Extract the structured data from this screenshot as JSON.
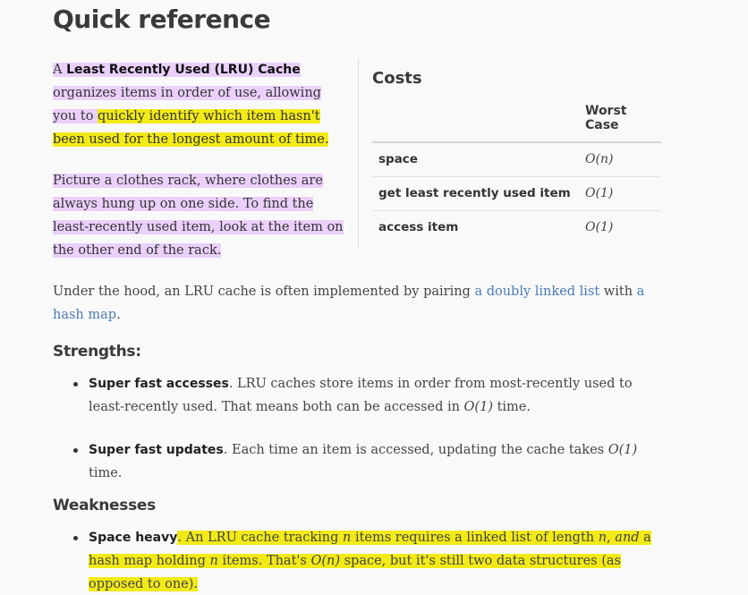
{
  "title": "Quick reference",
  "intro": {
    "p1": {
      "a": "A ",
      "term": "Least Recently Used (LRU) Cache",
      "rest": " organizes items in order of use, allowing you to ",
      "highlight": "quickly identify which item hasn't been used for the longest amount of time.",
      "end": ""
    },
    "p2": "Picture a clothes rack, where clothes are always hung up on one side. To find the least-recently used item, look at the item on the other end of the rack."
  },
  "costs": {
    "heading": "Costs",
    "col_header": "Worst Case",
    "rows": [
      {
        "op": "space",
        "cost": "O(n)"
      },
      {
        "op": "get least recently used item",
        "cost": "O(1)"
      },
      {
        "op": "access item",
        "cost": "O(1)"
      }
    ]
  },
  "hood": {
    "before": "Under the hood, an LRU cache is often implemented by pairing ",
    "link1": "a doubly linked list",
    "middle": " with ",
    "link2": "a hash map",
    "end": "."
  },
  "strengths": {
    "heading": "Strengths:",
    "items": [
      {
        "bold": "Super fast accesses",
        "text1": ". LRU caches store items in order from most-recently used to least-recently used. That means both can be accessed in ",
        "math": "O(1)",
        "text2": " time."
      },
      {
        "bold": "Super fast updates",
        "text1": ". Each time an item is accessed, updating the cache takes ",
        "math": "O(1)",
        "text2": " time."
      }
    ]
  },
  "weaknesses": {
    "heading": "Weaknesses",
    "items": [
      {
        "bold": "Space heavy",
        "t1": ". An LRU cache tracking ",
        "m1": "n",
        "t2": " items requires a linked list of length ",
        "m2": "n",
        "t3": ", ",
        "m3": "and",
        "t4": " a hash map holding ",
        "m4": "n",
        "t5": " items. That's ",
        "m5": "O(n)",
        "t6": " space, but it's still two data structures (as opposed to one)."
      }
    ]
  },
  "colors": {
    "purple_highlight": "#ead0fb",
    "yellow_highlight": "#f2ea17",
    "link": "#4a7ab8"
  }
}
